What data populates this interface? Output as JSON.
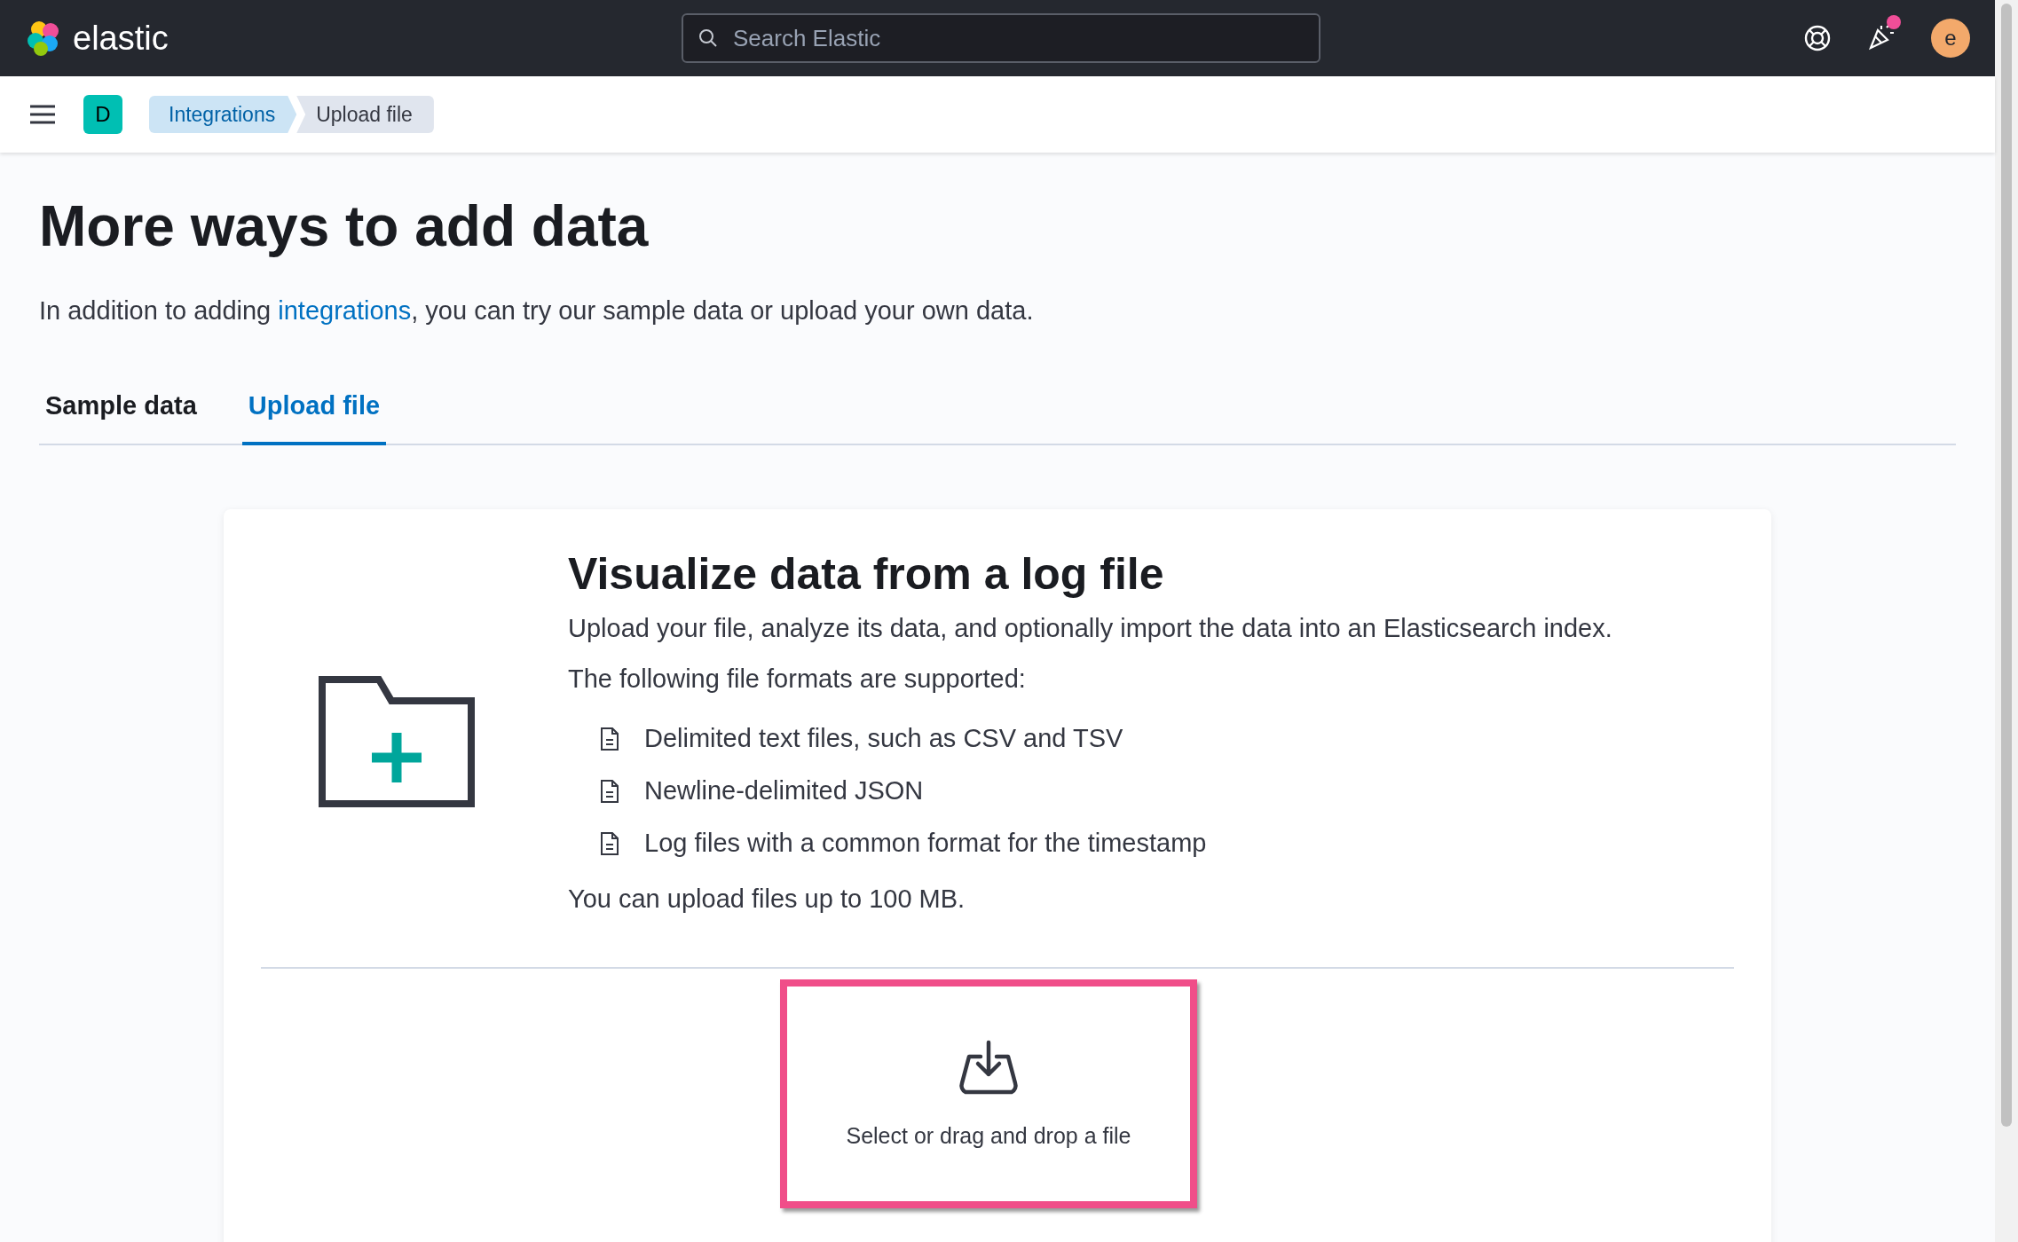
{
  "header": {
    "logo": "elastic",
    "search": {
      "placeholder": "Search Elastic"
    },
    "news_unread": true,
    "avatar": "e"
  },
  "nav": {
    "space": "D",
    "breadcrumbs": [
      {
        "label": "Integrations",
        "current": false
      },
      {
        "label": "Upload file",
        "current": true
      }
    ]
  },
  "page": {
    "title": "More ways to add data",
    "intro": [
      {
        "kind": "text",
        "text": "In addition to adding "
      },
      {
        "kind": "link",
        "text": "integrations"
      },
      {
        "kind": "text",
        "text": ", you can try our sample data or upload your own data."
      }
    ],
    "tabs": [
      {
        "label": "Sample data",
        "selected": false
      },
      {
        "label": "Upload file",
        "selected": true
      }
    ],
    "card": {
      "title": "Visualize data from a log file",
      "description": "Upload your file, analyze its data, and optionally import the data into an Elasticsearch index.",
      "formats_intro": "The following file formats are supported:",
      "formats": [
        "Delimited text files, such as CSV and TSV",
        "Newline-delimited JSON",
        "Log files with a common format for the timestamp"
      ],
      "size_note": "You can upload files up to 100 MB.",
      "dropzone": {
        "label": "Select or drag and drop a file",
        "highlighted": true
      }
    }
  }
}
